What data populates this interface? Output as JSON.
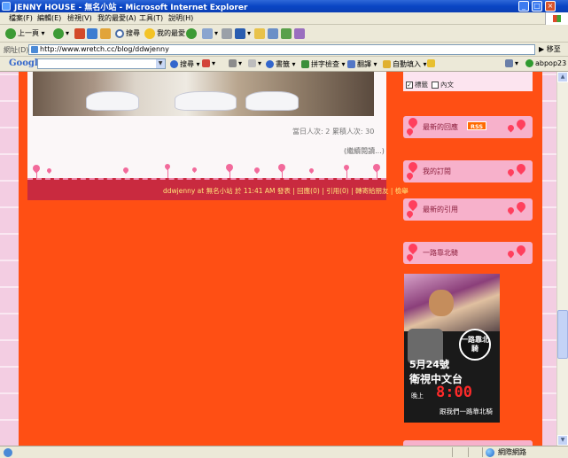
{
  "window": {
    "title": "JENNY HOUSE - 無名小站 - Microsoft Internet Explorer",
    "buttons": {
      "minimize": "_",
      "maximize": "□",
      "close": "×"
    }
  },
  "menu": [
    "檔案(F)",
    "編輯(E)",
    "檢視(V)",
    "我的最愛(A)",
    "工具(T)",
    "說明(H)"
  ],
  "toolbar": {
    "back_label": "上一頁",
    "search_label": "搜尋",
    "favorites_label": "我的最愛"
  },
  "address": {
    "label": "網址(D)",
    "url": "http://www.wretch.cc/blog/ddwjenny",
    "go_label": "移至"
  },
  "google_toolbar": {
    "logo": "Google",
    "search_button": "搜尋",
    "bookmarks": "書籤",
    "spellcheck": "拼字檢查",
    "translate": "翻譯",
    "autofill": "自動填入",
    "account": "abpop23"
  },
  "post": {
    "counter": "當日人次: 2 累積人次: 30",
    "read_more": "(繼續閱讀...)",
    "footer": "ddwjenny at 無名小站 於 11:41 AM 發表 | 回應(0) | 引用(0) | 轉寄給朋友 | 檢舉"
  },
  "sidebar": {
    "checkbox1_label": "標籤",
    "checkbox2_label": "內文",
    "boxes": [
      {
        "title": "最新的回應",
        "badge": "RSS"
      },
      {
        "title": "我的訂閱"
      },
      {
        "title": "最新的引用"
      },
      {
        "title": "一路靠北騎"
      }
    ],
    "promo": {
      "stamp": "一路靠北騎",
      "date": "5月24號",
      "channel": "衛視中文台",
      "time_prefix": "晚上",
      "time": "8:00",
      "tagline": "跟我們一路靠北騎"
    }
  },
  "status": {
    "zone": "網際網路"
  },
  "colors": {
    "page_orange": "#ff4f14",
    "footer_red": "#c92a3f",
    "footer_text": "#ffe67a",
    "sidebar_pink": "#f7b1cb"
  }
}
